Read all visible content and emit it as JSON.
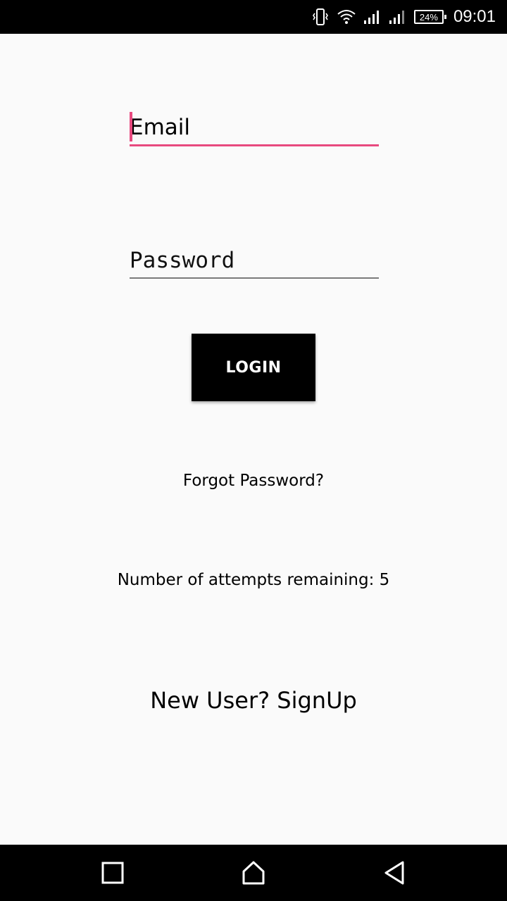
{
  "status_bar": {
    "battery": "24%",
    "time": "09:01",
    "icons": [
      "vibrate-icon",
      "wifi-icon",
      "signal-icon",
      "signal-icon-2",
      "battery-icon"
    ]
  },
  "login_form": {
    "email_placeholder": "Email",
    "email_value": "",
    "password_placeholder": "Password",
    "password_value": "",
    "login_label": "LOGIN",
    "forgot_label": "Forgot Password?",
    "attempts_text": "Number of attempts remaining: 5",
    "signup_label": "New User? SignUp"
  },
  "nav_bar": {
    "icons": [
      "recents-icon",
      "home-icon",
      "back-icon"
    ]
  },
  "colors": {
    "accent": "#e84a7f",
    "background": "#fafafa",
    "button": "#000000"
  }
}
